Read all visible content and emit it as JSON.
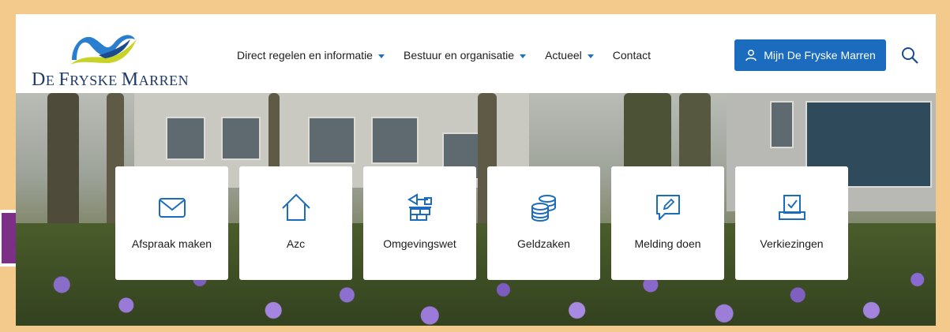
{
  "logo": {
    "text_initial1": "D",
    "text_rest1": "E ",
    "text_initial2": "F",
    "text_rest2": "RYSKE ",
    "text_initial3": "M",
    "text_rest3": "ARREN"
  },
  "nav": {
    "items": [
      {
        "label": "Direct regelen en informatie",
        "dropdown": true
      },
      {
        "label": "Bestuur en organisatie",
        "dropdown": true
      },
      {
        "label": "Actueel",
        "dropdown": true
      },
      {
        "label": "Contact",
        "dropdown": false
      }
    ]
  },
  "account": {
    "label": "Mijn De Fryske Marren",
    "icon": "user-icon"
  },
  "search": {
    "icon": "search-icon"
  },
  "tiles": [
    {
      "label": "Afspraak maken",
      "icon": "envelope-icon"
    },
    {
      "label": "Azc",
      "icon": "house-icon"
    },
    {
      "label": "Omgevingswet",
      "icon": "building-blocks-icon"
    },
    {
      "label": "Geldzaken",
      "icon": "coins-icon"
    },
    {
      "label": "Melding doen",
      "icon": "message-pencil-icon"
    },
    {
      "label": "Verkiezingen",
      "icon": "ballot-box-icon"
    }
  ],
  "colors": {
    "primary": "#1b6cbf",
    "border": "#f3c98c",
    "arrow": "#7b2f85"
  }
}
